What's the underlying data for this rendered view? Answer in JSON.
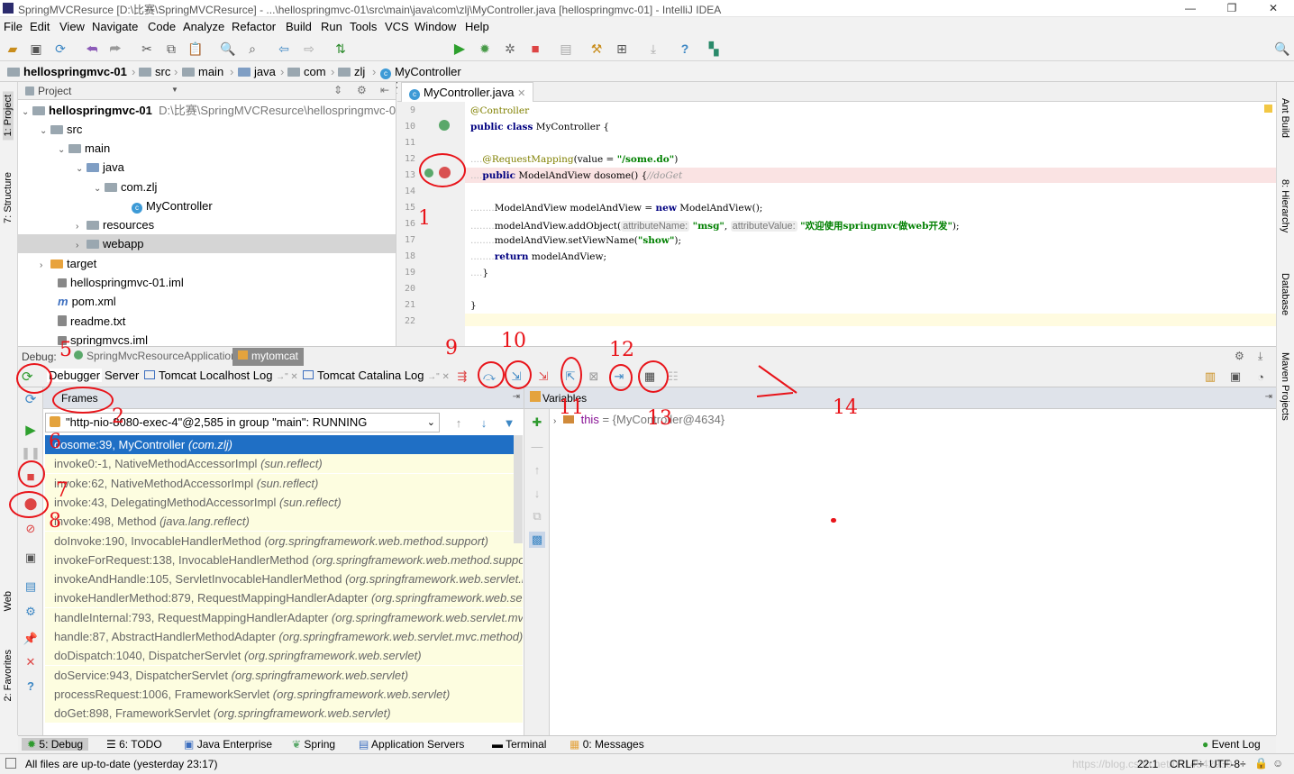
{
  "window": {
    "title": "SpringMVCResurce [D:\\比赛\\SpringMVCResurce] - ...\\hellospringmvc-01\\src\\main\\java\\com\\zlj\\MyController.java [hellospringmvc-01] - IntelliJ IDEA"
  },
  "menu": [
    "File",
    "Edit",
    "View",
    "Navigate",
    "Code",
    "Analyze",
    "Refactor",
    "Build",
    "Run",
    "Tools",
    "VCS",
    "Window",
    "Help"
  ],
  "toolbar": {
    "run_config": "mytomcat"
  },
  "breadcrumb": [
    "hellospringmvc-01",
    "src",
    "main",
    "java",
    "com",
    "zlj",
    "MyController"
  ],
  "left_stripe": {
    "project": "1: Project",
    "structure": "7: Structure",
    "web": "Web",
    "favorites": "2: Favorites"
  },
  "right_stripe": {
    "ant": "Ant Build",
    "hierarchy": "8: Hierarchy",
    "database": "Database",
    "maven": "Maven Projects"
  },
  "project_panel": {
    "header": "Project",
    "root_name": "hellospringmvc-01",
    "root_path": "D:\\比赛\\SpringMVCResurce\\hellospringmvc-01",
    "items": [
      "src",
      "main",
      "java",
      "com.zlj",
      "MyController",
      "resources",
      "webapp",
      "target",
      "hellospringmvc-01.iml",
      "pom.xml",
      "readme.txt",
      "springmvcs.iml"
    ]
  },
  "editor": {
    "tab": "MyController.java",
    "line_numbers": [
      "9",
      "10",
      "11",
      "12",
      "13",
      "14",
      "15",
      "16",
      "17",
      "18",
      "19",
      "20",
      "21",
      "22"
    ],
    "code": {
      "l9": "@Controller",
      "l10_kw": "public class",
      "l10_rest": " MyController {",
      "l12_ann": "@RequestMapping",
      "l12_a": "(value = ",
      "l12_str": "\"/some.do\"",
      "l12_b": ")",
      "l13_kw": "public",
      "l13_rest": " ModelAndView dosome() {",
      "l13_cmt": "//doGet",
      "l15_a": "ModelAndView modelAndView = ",
      "l15_kw": "new",
      "l15_b": " ModelAndView();",
      "l16_a": "modelAndView.addObject(",
      "l16_h1": "attributeName:",
      "l16_s1": "\"msg\"",
      "l16_h2": "attributeValue:",
      "l16_s2": "\"欢迎使用springmvc做web开发\"",
      "l16_b": ");",
      "l17_a": "modelAndView.setViewName(",
      "l17_s": "\"show\"",
      "l17_b": ");",
      "l18_kw": "return",
      "l18_rest": " modelAndView;",
      "l19": "}",
      "l21": "}"
    }
  },
  "debug": {
    "label": "Debug:",
    "sessions": [
      "SpringMvcResourceApplication",
      "mytomcat"
    ],
    "tabs": [
      "Debugger",
      "Server",
      "Tomcat Localhost Log",
      "Tomcat Catalina Log"
    ],
    "frames_header": "Frames",
    "variables_header": "Variables",
    "thread": "\"http-nio-8080-exec-4\"@2,585 in group \"main\": RUNNING",
    "frames": [
      {
        "m": "dosome:39, MyController",
        "p": "(com.zlj)"
      },
      {
        "m": "invoke0:-1, NativeMethodAccessorImpl",
        "p": "(sun.reflect)"
      },
      {
        "m": "invoke:62, NativeMethodAccessorImpl",
        "p": "(sun.reflect)"
      },
      {
        "m": "invoke:43, DelegatingMethodAccessorImpl",
        "p": "(sun.reflect)"
      },
      {
        "m": "invoke:498, Method",
        "p": "(java.lang.reflect)"
      },
      {
        "m": "doInvoke:190, InvocableHandlerMethod",
        "p": "(org.springframework.web.method.support)"
      },
      {
        "m": "invokeForRequest:138, InvocableHandlerMethod",
        "p": "(org.springframework.web.method.support)"
      },
      {
        "m": "invokeAndHandle:105, ServletInvocableHandlerMethod",
        "p": "(org.springframework.web.servlet.mvc)"
      },
      {
        "m": "invokeHandlerMethod:879, RequestMappingHandlerAdapter",
        "p": "(org.springframework.web.servlet)"
      },
      {
        "m": "handleInternal:793, RequestMappingHandlerAdapter",
        "p": "(org.springframework.web.servlet.mvc)"
      },
      {
        "m": "handle:87, AbstractHandlerMethodAdapter",
        "p": "(org.springframework.web.servlet.mvc.method)"
      },
      {
        "m": "doDispatch:1040, DispatcherServlet",
        "p": "(org.springframework.web.servlet)"
      },
      {
        "m": "doService:943, DispatcherServlet",
        "p": "(org.springframework.web.servlet)"
      },
      {
        "m": "processRequest:1006, FrameworkServlet",
        "p": "(org.springframework.web.servlet)"
      },
      {
        "m": "doGet:898, FrameworkServlet",
        "p": "(org.springframework.web.servlet)"
      }
    ],
    "variable": {
      "name": "this",
      "value": "= {MyController@4634}"
    }
  },
  "bottom_tabs": [
    "5: Debug",
    "6: TODO",
    "Java Enterprise",
    "Spring",
    "Application Servers",
    "Terminal",
    "0: Messages",
    "Event Log"
  ],
  "status": {
    "message": "All files are up-to-date (yesterday 23:17)",
    "position": "22:1",
    "line_sep": "CRLF÷",
    "encoding": "UTF-8÷",
    "watermark": "https://blog.csdn.net/u014542930"
  },
  "annotations": [
    "1",
    "2",
    "5",
    "6",
    "7",
    "8",
    "9",
    "10",
    "11",
    "12",
    "13",
    "14"
  ],
  "colors": {
    "annotation": "#e8141a",
    "selection": "#1f6fc5",
    "frames_bg": "#fdfde0"
  }
}
